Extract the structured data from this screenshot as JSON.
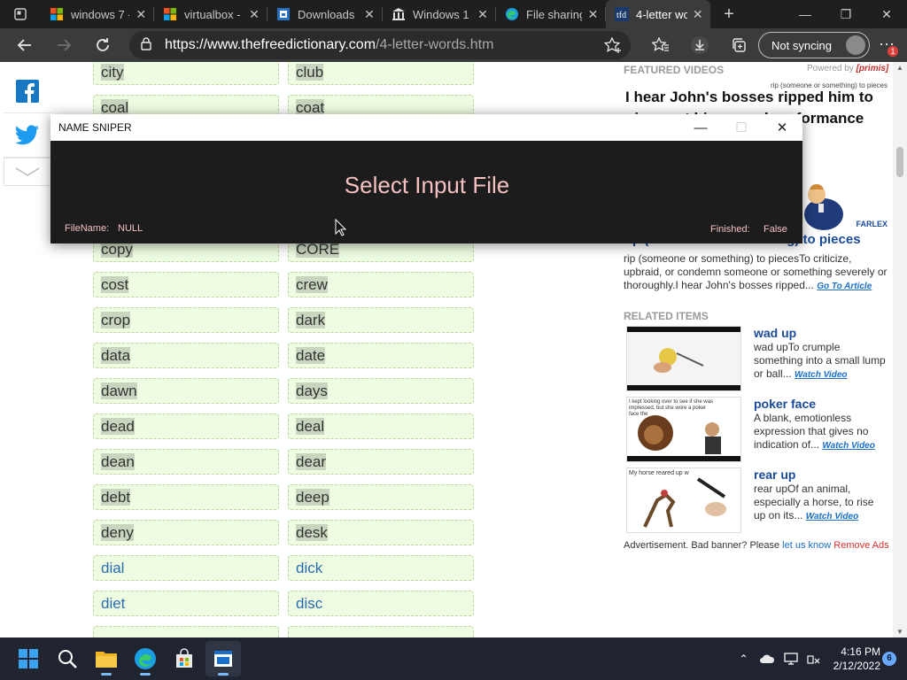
{
  "browser": {
    "tabs": [
      {
        "title": "windows 7 -",
        "icon": "windows-logo"
      },
      {
        "title": "virtualbox -",
        "icon": "windows-logo"
      },
      {
        "title": "Downloads",
        "icon": "downloads-page"
      },
      {
        "title": "Windows 1",
        "icon": "library-building"
      },
      {
        "title": "File sharing",
        "icon": "edge-file-sharing"
      },
      {
        "title": "4-letter wor",
        "icon": "thefreedictionary"
      }
    ],
    "url_host": "https://www.thefreedictionary.com",
    "url_path": "/4-letter-words.htm",
    "sync_label": "Not syncing",
    "notification_badge": "1",
    "accent": "#3b3b3b"
  },
  "page": {
    "words_left": [
      {
        "text": "city",
        "highlighted": true,
        "link": false
      },
      {
        "text": "coal",
        "highlighted": true,
        "link": false
      },
      {
        "text": "copy",
        "highlighted": true,
        "link": false
      },
      {
        "text": "cost",
        "highlighted": true,
        "link": false
      },
      {
        "text": "crop",
        "highlighted": true,
        "link": false
      },
      {
        "text": "data",
        "highlighted": true,
        "link": false
      },
      {
        "text": "dawn",
        "highlighted": true,
        "link": false
      },
      {
        "text": "dead",
        "highlighted": true,
        "link": false
      },
      {
        "text": "dean",
        "highlighted": true,
        "link": false
      },
      {
        "text": "debt",
        "highlighted": true,
        "link": false
      },
      {
        "text": "deny",
        "highlighted": true,
        "link": false
      },
      {
        "text": "dial",
        "highlighted": false,
        "link": true
      },
      {
        "text": "diet",
        "highlighted": false,
        "link": true
      }
    ],
    "words_right": [
      {
        "text": "club",
        "highlighted": true,
        "link": false
      },
      {
        "text": "coat",
        "highlighted": true,
        "link": false
      },
      {
        "text": "CORE",
        "highlighted": true,
        "link": false
      },
      {
        "text": "crew",
        "highlighted": true,
        "link": false
      },
      {
        "text": "dark",
        "highlighted": true,
        "link": false
      },
      {
        "text": "date",
        "highlighted": true,
        "link": false
      },
      {
        "text": "days",
        "highlighted": true,
        "link": false
      },
      {
        "text": "deal",
        "highlighted": true,
        "link": false
      },
      {
        "text": "dear",
        "highlighted": true,
        "link": false
      },
      {
        "text": "deep",
        "highlighted": true,
        "link": false
      },
      {
        "text": "desk",
        "highlighted": true,
        "link": false
      },
      {
        "text": "dick",
        "highlighted": false,
        "link": true
      },
      {
        "text": "disc",
        "highlighted": false,
        "link": true
      }
    ],
    "featured": {
      "heading": "FEATURED VIDEOS",
      "powered_by": "Powered by",
      "powered_brand": "[primis]",
      "video_caption_small": "rip (someone or something) to pieces",
      "video_quote": "I hear John's bosses ripped him to pieces at his annual performance review.",
      "farlex": "FARLEX",
      "title": "rip (someone or something) to pieces",
      "desc": "rip (someone or something) to piecesTo criticize, upbraid, or condemn someone or something severely or thoroughly.I hear John's bosses ripped...",
      "link": "Go To Article"
    },
    "related": {
      "heading": "RELATED ITEMS",
      "items": [
        {
          "title": "wad up",
          "desc": "wad upTo crumple something into a small lump or ball...",
          "link": "Watch Video"
        },
        {
          "title": "poker face",
          "desc": "A blank, emotionless expression that gives no indication of...",
          "link": "Watch Video"
        },
        {
          "title": "rear up",
          "desc": "rear upOf an animal, especially a horse, to rise up on its...",
          "link": "Watch Video"
        }
      ],
      "thumb_caption_poker": "I kept looking over to see if she was impressed, but she wore a poker face the",
      "thumb_caption_rear": "My horse reared up w"
    },
    "ad_text": "Advertisement. Bad banner? Please",
    "ad_link": "let us know",
    "ad_remove": "Remove Ads"
  },
  "dialog": {
    "title": "NAME SNIPER",
    "select_label": "Select Input File",
    "filename_label": "FileName:",
    "filename_value": "NULL",
    "finished_label": "Finished:",
    "finished_value": "False"
  },
  "taskbar": {
    "time": "4:16 PM",
    "date": "2/12/2022",
    "notifications": "6"
  }
}
